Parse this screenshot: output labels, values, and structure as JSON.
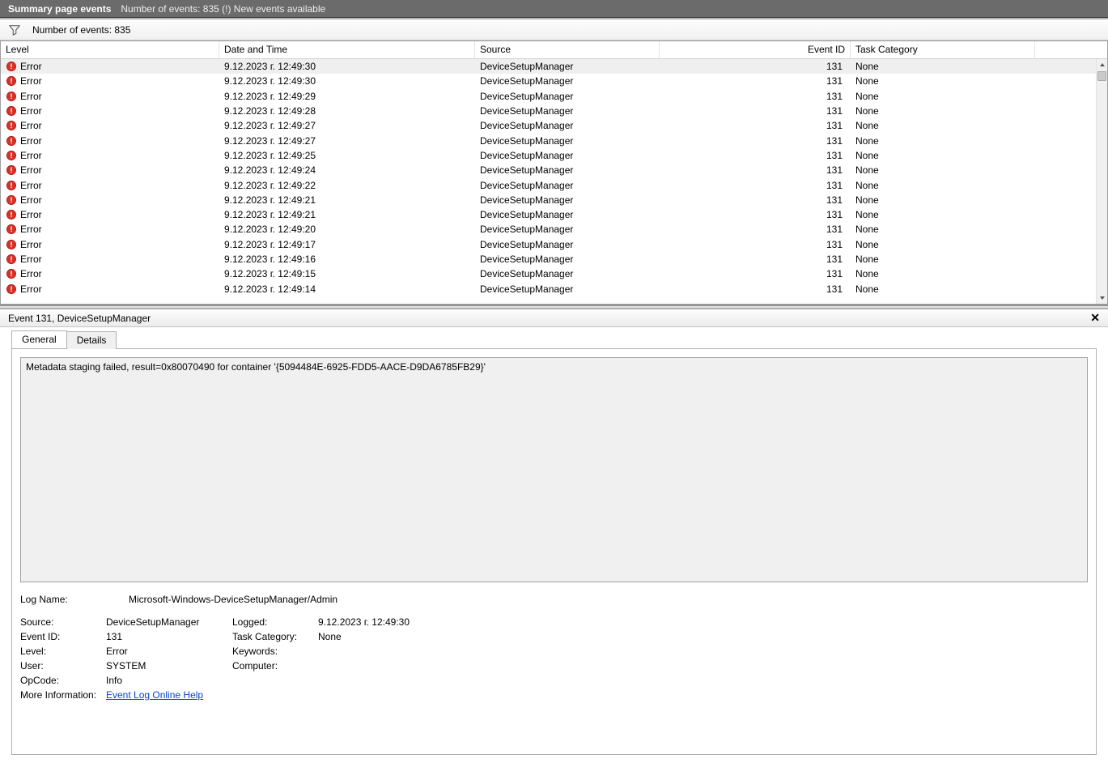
{
  "topbar": {
    "title": "Summary page events",
    "sub": "Number of events: 835 (!) New events available"
  },
  "filterbar": {
    "count": "Number of events: 835"
  },
  "grid": {
    "headers": {
      "level": "Level",
      "date": "Date and Time",
      "source": "Source",
      "eventid": "Event ID",
      "task": "Task Category"
    },
    "rows": [
      {
        "level": "Error",
        "date": "9.12.2023 г. 12:49:30",
        "source": "DeviceSetupManager",
        "eventid": "131",
        "task": "None"
      },
      {
        "level": "Error",
        "date": "9.12.2023 г. 12:49:30",
        "source": "DeviceSetupManager",
        "eventid": "131",
        "task": "None"
      },
      {
        "level": "Error",
        "date": "9.12.2023 г. 12:49:29",
        "source": "DeviceSetupManager",
        "eventid": "131",
        "task": "None"
      },
      {
        "level": "Error",
        "date": "9.12.2023 г. 12:49:28",
        "source": "DeviceSetupManager",
        "eventid": "131",
        "task": "None"
      },
      {
        "level": "Error",
        "date": "9.12.2023 г. 12:49:27",
        "source": "DeviceSetupManager",
        "eventid": "131",
        "task": "None"
      },
      {
        "level": "Error",
        "date": "9.12.2023 г. 12:49:27",
        "source": "DeviceSetupManager",
        "eventid": "131",
        "task": "None"
      },
      {
        "level": "Error",
        "date": "9.12.2023 г. 12:49:25",
        "source": "DeviceSetupManager",
        "eventid": "131",
        "task": "None"
      },
      {
        "level": "Error",
        "date": "9.12.2023 г. 12:49:24",
        "source": "DeviceSetupManager",
        "eventid": "131",
        "task": "None"
      },
      {
        "level": "Error",
        "date": "9.12.2023 г. 12:49:22",
        "source": "DeviceSetupManager",
        "eventid": "131",
        "task": "None"
      },
      {
        "level": "Error",
        "date": "9.12.2023 г. 12:49:21",
        "source": "DeviceSetupManager",
        "eventid": "131",
        "task": "None"
      },
      {
        "level": "Error",
        "date": "9.12.2023 г. 12:49:21",
        "source": "DeviceSetupManager",
        "eventid": "131",
        "task": "None"
      },
      {
        "level": "Error",
        "date": "9.12.2023 г. 12:49:20",
        "source": "DeviceSetupManager",
        "eventid": "131",
        "task": "None"
      },
      {
        "level": "Error",
        "date": "9.12.2023 г. 12:49:17",
        "source": "DeviceSetupManager",
        "eventid": "131",
        "task": "None"
      },
      {
        "level": "Error",
        "date": "9.12.2023 г. 12:49:16",
        "source": "DeviceSetupManager",
        "eventid": "131",
        "task": "None"
      },
      {
        "level": "Error",
        "date": "9.12.2023 г. 12:49:15",
        "source": "DeviceSetupManager",
        "eventid": "131",
        "task": "None"
      },
      {
        "level": "Error",
        "date": "9.12.2023 г. 12:49:14",
        "source": "DeviceSetupManager",
        "eventid": "131",
        "task": "None"
      }
    ]
  },
  "detail": {
    "header": "Event 131, DeviceSetupManager",
    "tabs": {
      "general": "General",
      "details": "Details"
    },
    "message": "Metadata staging failed, result=0x80070490 for container '{5094484E-6925-FDD5-AACE-D9DA6785FB29}'",
    "meta": {
      "logname_label": "Log Name:",
      "logname": "Microsoft-Windows-DeviceSetupManager/Admin",
      "source_label": "Source:",
      "source": "DeviceSetupManager",
      "logged_label": "Logged:",
      "logged": "9.12.2023 г. 12:49:30",
      "eventid_label": "Event ID:",
      "eventid": "131",
      "taskcat_label": "Task Category:",
      "taskcat": "None",
      "level_label": "Level:",
      "level": "Error",
      "keywords_label": "Keywords:",
      "keywords": "",
      "user_label": "User:",
      "user": "SYSTEM",
      "computer_label": "Computer:",
      "computer": "",
      "opcode_label": "OpCode:",
      "opcode": "Info",
      "moreinfo_label": "More Information:",
      "moreinfo_link": "Event Log Online Help"
    }
  }
}
